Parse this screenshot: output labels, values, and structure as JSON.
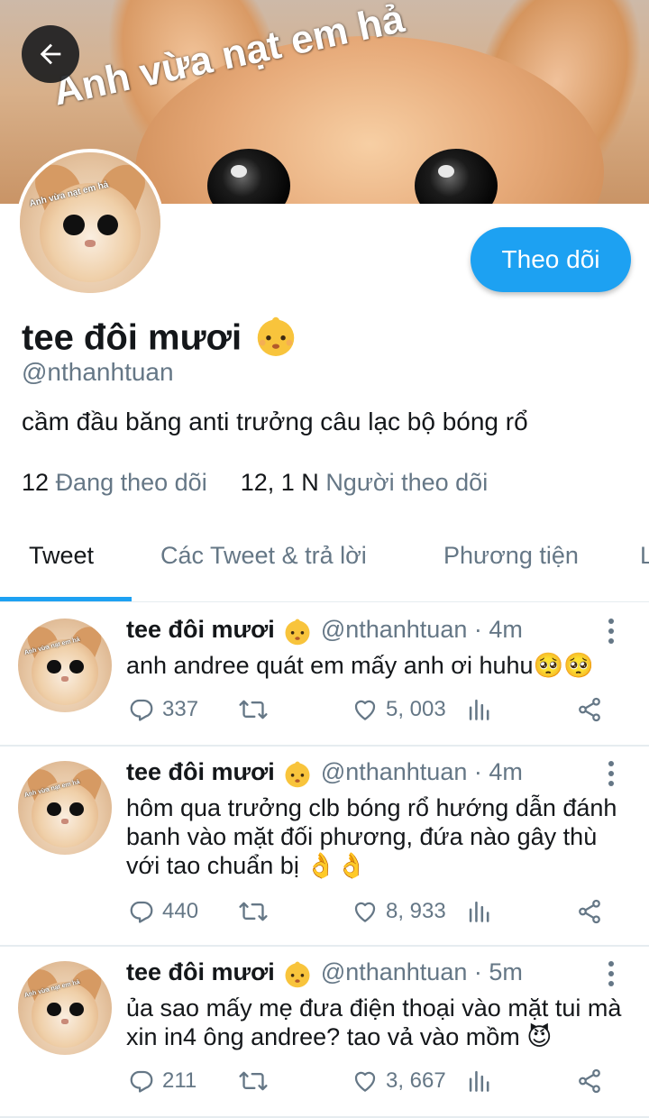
{
  "banner": {
    "caption": "Anh vừa nạt em hả"
  },
  "avatar_caption": "Anh vừa nạt em hả",
  "profile": {
    "display_name": "tee đôi mươi",
    "handle": "@nthanhtuan",
    "bio": "cầm đầu băng anti trưởng câu lạc bộ bóng rổ",
    "following_count": "12",
    "following_label": "Đang theo dõi",
    "followers_count": "12, 1 N",
    "followers_label": "Người theo dõi",
    "follow_button": "Theo dõi"
  },
  "tabs": [
    {
      "label": "Tweet",
      "active": true
    },
    {
      "label": "Các Tweet & trả lời",
      "active": false
    },
    {
      "label": "Phương tiện",
      "active": false
    },
    {
      "label": "L",
      "active": false
    }
  ],
  "tweets": [
    {
      "name": "tee đôi mươi",
      "handle": "@nthanhtuan",
      "time": "4m",
      "text": "anh andree quát em mấy anh ơi huhu🥺🥺",
      "replies": "337",
      "retweets": "",
      "likes": "5, 003"
    },
    {
      "name": "tee đôi mươi",
      "handle": "@nthanhtuan",
      "time": "4m",
      "text": "hôm qua trưởng clb bóng rổ hướng dẫn đánh banh vào mặt đối phương, đứa nào gây thù với tao chuẩn bị 👌👌",
      "replies": "440",
      "retweets": "",
      "likes": "8, 933"
    },
    {
      "name": "tee đôi mươi",
      "handle": "@nthanhtuan",
      "time": "5m",
      "text": "ủa sao mấy mẹ đưa điện thoại vào mặt tui mà xin in4 ông andree? tao vả vào mồm 😈",
      "replies": "211",
      "retweets": "",
      "likes": "3, 667"
    }
  ],
  "colors": {
    "accent": "#1da1f2",
    "secondary_text": "#657786",
    "primary_text": "#14171a"
  },
  "icons": {
    "back": "arrow-left-icon",
    "reply": "reply-icon",
    "retweet": "retweet-icon",
    "like": "heart-icon",
    "analytics": "analytics-icon",
    "share": "share-icon",
    "more": "more-vertical-icon"
  }
}
